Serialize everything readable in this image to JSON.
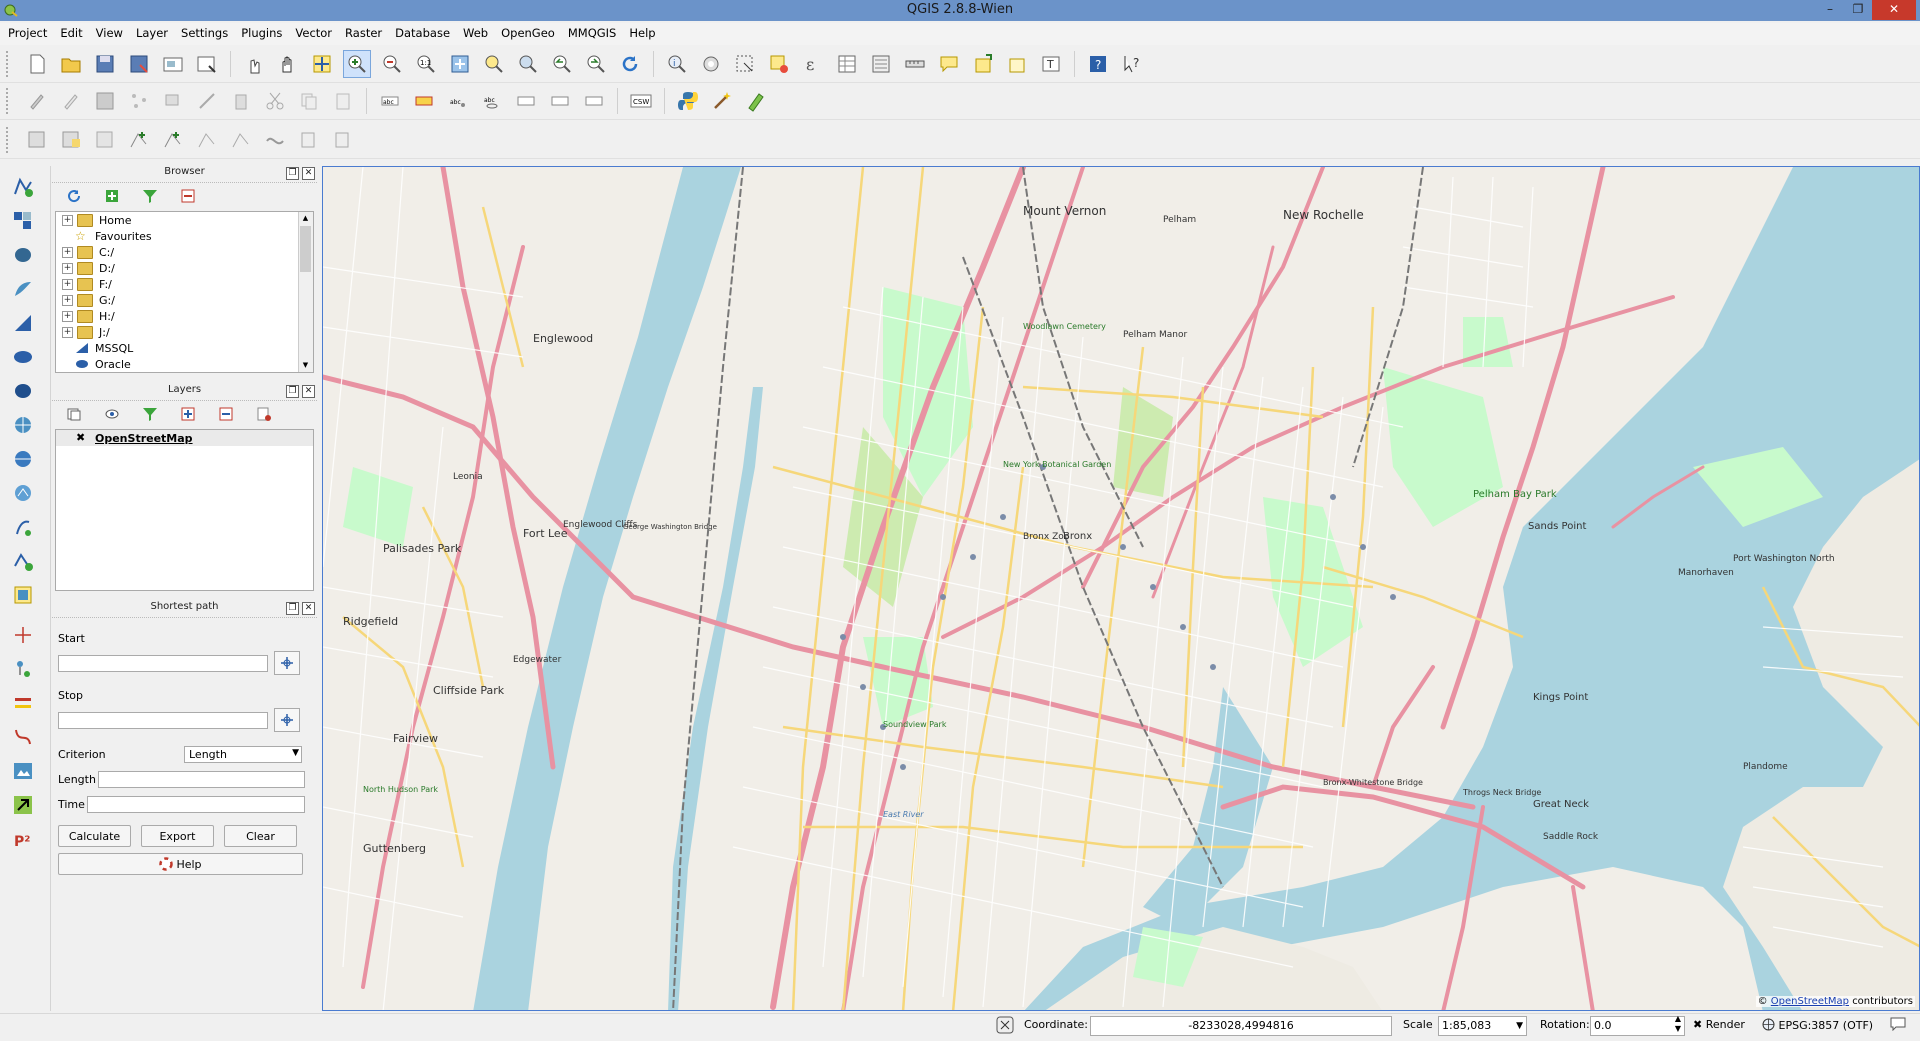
{
  "window": {
    "title": "QGIS 2.8.8-Wien",
    "controls": [
      "–",
      "❐",
      "✕"
    ]
  },
  "menu": [
    "Project",
    "Edit",
    "View",
    "Layer",
    "Settings",
    "Plugins",
    "Vector",
    "Raster",
    "Database",
    "Web",
    "OpenGeo",
    "MMQGIS",
    "Help"
  ],
  "browser": {
    "title": "Browser",
    "items": [
      {
        "label": "Home",
        "expandable": true,
        "icon": "folder-icon"
      },
      {
        "label": "Favourites",
        "expandable": false,
        "icon": "star-icon"
      },
      {
        "label": "C:/",
        "expandable": true,
        "icon": "folder-icon"
      },
      {
        "label": "D:/",
        "expandable": true,
        "icon": "folder-icon"
      },
      {
        "label": "F:/",
        "expandable": true,
        "icon": "folder-icon"
      },
      {
        "label": "G:/",
        "expandable": true,
        "icon": "folder-icon"
      },
      {
        "label": "H:/",
        "expandable": true,
        "icon": "folder-icon"
      },
      {
        "label": "J:/",
        "expandable": true,
        "icon": "folder-icon"
      },
      {
        "label": "MSSQL",
        "expandable": false,
        "icon": "mssql-icon"
      },
      {
        "label": "Oracle",
        "expandable": false,
        "icon": "oracle-icon"
      }
    ]
  },
  "layers": {
    "title": "Layers",
    "items": [
      {
        "label": "OpenStreetMap",
        "checked": true
      }
    ]
  },
  "shortest_path": {
    "title": "Shortest path",
    "start_label": "Start",
    "start_value": "",
    "stop_label": "Stop",
    "stop_value": "",
    "criterion_label": "Criterion",
    "criterion_value": "Length",
    "length_label": "Length",
    "length_value": "",
    "time_label": "Time",
    "time_value": "",
    "calculate": "Calculate",
    "export": "Export",
    "clear": "Clear",
    "help": "Help"
  },
  "map": {
    "labels": {
      "mount_vernon": "Mount Vernon",
      "new_rochelle": "New Rochelle",
      "pelham": "Pelham",
      "pelham_manor": "Pelham Manor",
      "pelham_bay_park": "Pelham Bay Park",
      "englewood": "Englewood",
      "englewood_cliffs": "Englewood Cliffs",
      "leonia": "Leonia",
      "fort_lee": "Fort Lee",
      "palisades_park": "Palisades Park",
      "ridgefield": "Ridgefield",
      "cliffside_park": "Cliffside Park",
      "fairview": "Fairview",
      "guttenberg": "Guttenberg",
      "edgewater": "Edgewater",
      "bronx": "Bronx",
      "bronx_zoo": "Bronx Zoo",
      "botanical_garden": "New York Botanical Garden",
      "woodlawn": "Woodlawn Cemetery",
      "sands_point": "Sands Point",
      "port_washington": "Port Washington North",
      "kings_point": "Kings Point",
      "great_neck": "Great Neck",
      "saddle_rock": "Saddle Rock",
      "plandome": "Plandome",
      "manorhaven": "Manorhaven",
      "throgs_neck": "Throgs Neck Bridge",
      "whitestone": "Bronx-Whitestone Bridge",
      "gw_bridge": "George Washington Bridge",
      "north_hudson_park": "North Hudson Park",
      "soundview_park": "Soundview Park",
      "east_river": "East River",
      "mt_vernon_label": "Mount Vernon"
    },
    "attribution_link": "OpenStreetMap",
    "attribution_suffix": "contributors"
  },
  "status": {
    "coordinate_label": "Coordinate:",
    "coordinate_value": "-8233028,4994816",
    "scale_label": "Scale",
    "scale_value": "1:85,083",
    "rotation_label": "Rotation:",
    "rotation_value": "0.0",
    "render_label": "Render",
    "crs": "EPSG:3857 (OTF)"
  }
}
